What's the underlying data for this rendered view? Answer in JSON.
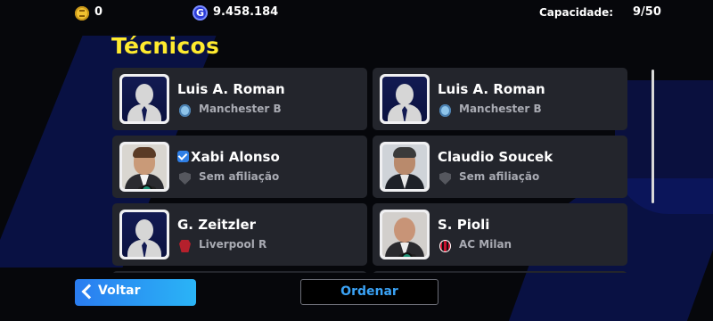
{
  "header": {
    "coins": "0",
    "gp_icon": "G",
    "gp": "9.458.184",
    "capacity_label": "Capacidade:",
    "capacity_value": "9/50"
  },
  "page_title": "Técnicos",
  "managers": [
    {
      "name": "Luis A. Roman",
      "club": "Manchester B",
      "portrait": "generic-silhouette",
      "club_icon": "manchester-b-crest-icon",
      "verified": false
    },
    {
      "name": "Luis A. Roman",
      "club": "Manchester B",
      "portrait": "generic-silhouette",
      "club_icon": "manchester-b-crest-icon",
      "verified": false
    },
    {
      "name": "Xabi Alonso",
      "club": "Sem afiliação",
      "portrait": "photo",
      "club_icon": "no-affiliation-shield-icon",
      "verified": true
    },
    {
      "name": "Claudio Soucek",
      "club": "Sem afiliação",
      "portrait": "photo",
      "club_icon": "no-affiliation-shield-icon",
      "verified": false
    },
    {
      "name": "G. Zeitzler",
      "club": "Liverpool R",
      "portrait": "generic-silhouette",
      "club_icon": "liverpool-r-crest-icon",
      "verified": false
    },
    {
      "name": "S. Pioli",
      "club": "AC Milan",
      "portrait": "photo",
      "club_icon": "ac-milan-crest-icon",
      "verified": false
    }
  ],
  "buttons": {
    "back": "Voltar",
    "sort": "Ordenar"
  },
  "colors": {
    "title": "#ffeb2e",
    "card": "#23252c",
    "back_button": "#2a7cf0",
    "sort_text": "#3aa2f5"
  }
}
